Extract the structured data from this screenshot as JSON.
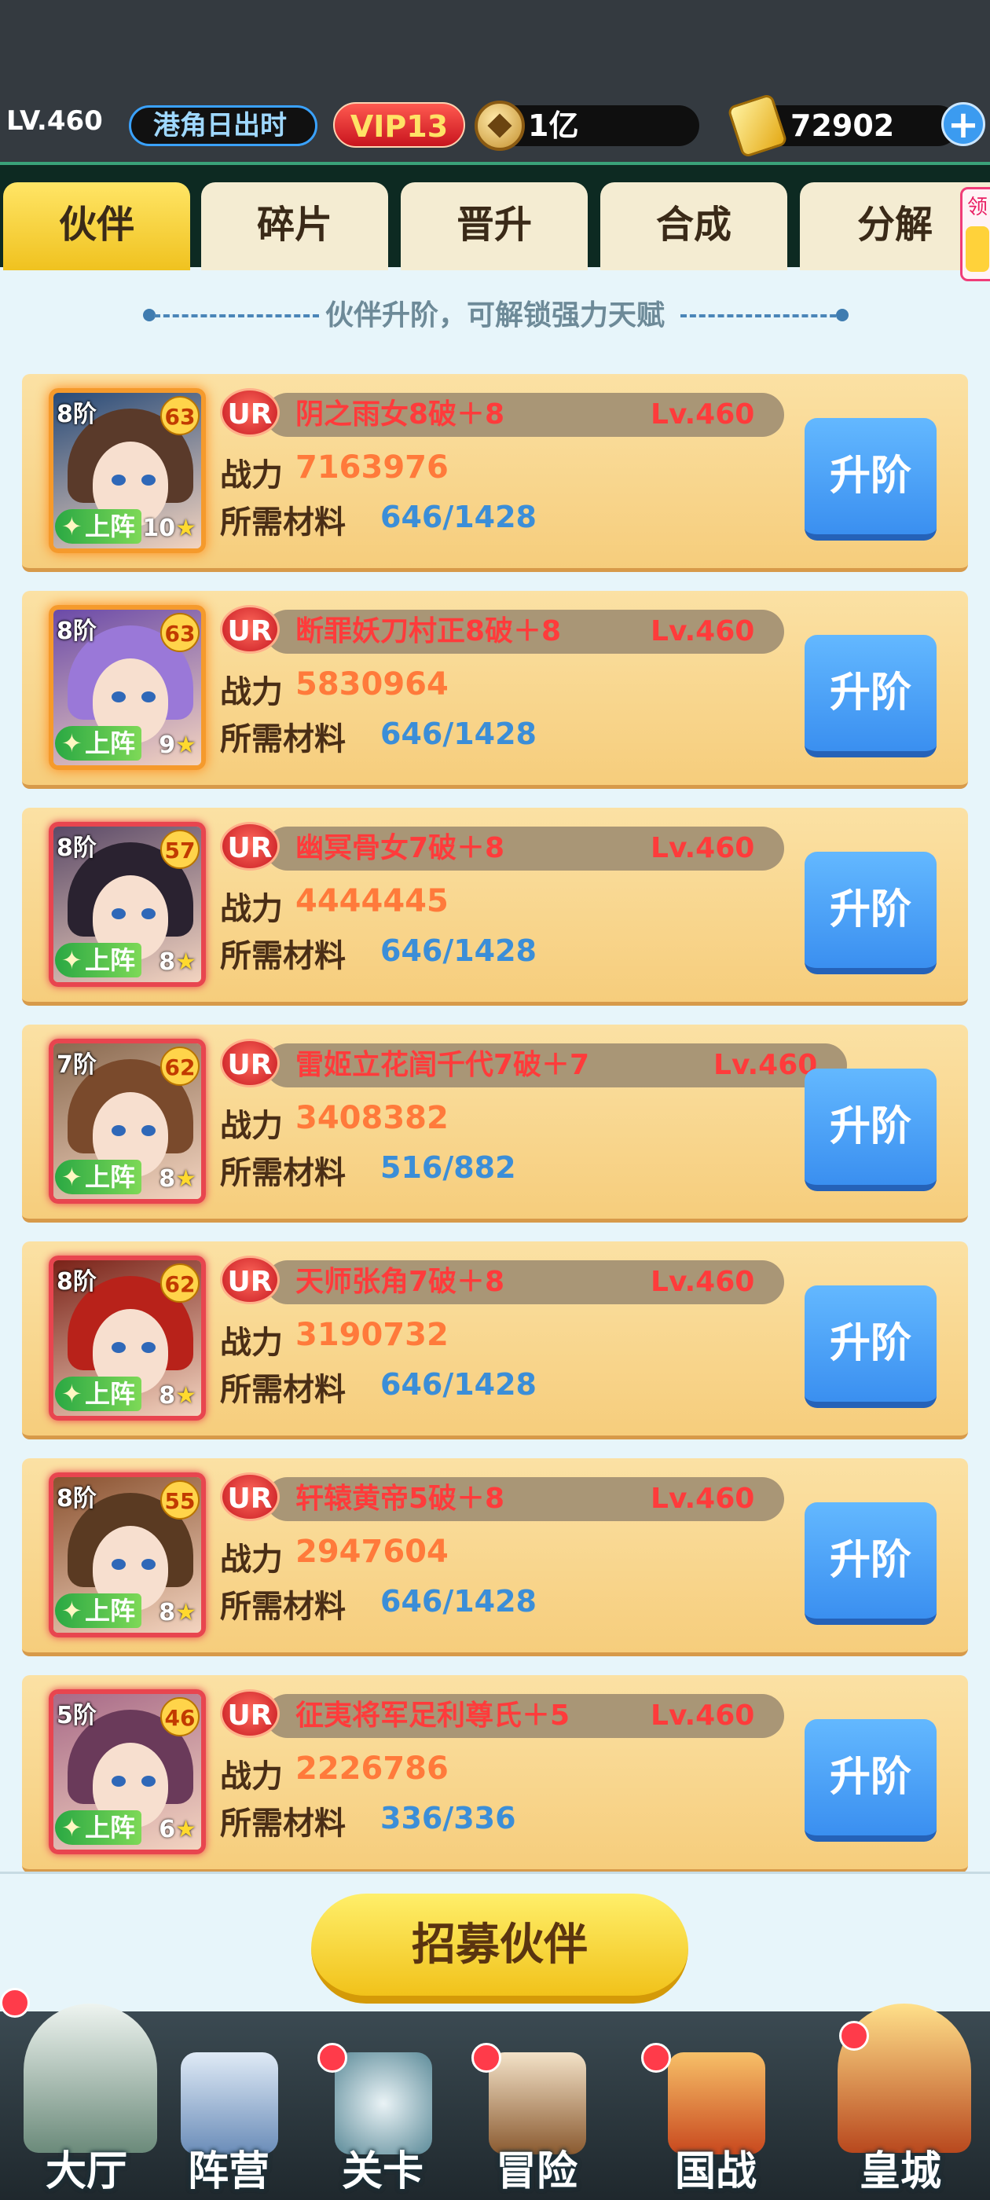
{
  "header": {
    "level": "LV.460",
    "player_name": "港角日出时",
    "vip": "VIP13",
    "coins": "1亿",
    "gold": "72902",
    "plus_icon": "plus-icon"
  },
  "tabs": [
    "伙伴",
    "碎片",
    "晋升",
    "合成",
    "分解"
  ],
  "active_tab": 0,
  "side_gift": "领",
  "hint": "伙伴升阶，可解锁强力天赋",
  "labels": {
    "power": "战力",
    "materials": "所需材料",
    "upgrade": "升阶",
    "deploy": "上阵",
    "rarity": "UR"
  },
  "partners": [
    {
      "tier": "8阶",
      "tier_level": "63",
      "stars": "10",
      "name": "阴之雨女8破＋8",
      "level": "Lv.460",
      "power": "7163976",
      "materials": "646/1428",
      "hair": "#5a3a2a",
      "bg": "#274a78",
      "frame": "orange"
    },
    {
      "tier": "8阶",
      "tier_level": "63",
      "stars": "9",
      "name": "断罪妖刀村正8破＋8",
      "level": "Lv.460",
      "power": "5830964",
      "materials": "646/1428",
      "hair": "#9a78d8",
      "bg": "#6b4aa8",
      "frame": "orange"
    },
    {
      "tier": "8阶",
      "tier_level": "57",
      "stars": "8",
      "name": "幽冥骨女7破＋8",
      "level": "Lv.460",
      "power": "4444445",
      "materials": "646/1428",
      "hair": "#2a2230",
      "bg": "#5b4a68",
      "frame": "red"
    },
    {
      "tier": "7阶",
      "tier_level": "62",
      "stars": "8",
      "name": "雷姬立花訚千代7破＋7",
      "level": "Lv.460",
      "power": "3408382",
      "materials": "516/882",
      "hair": "#7a4a2c",
      "bg": "#8a6a50",
      "frame": "red"
    },
    {
      "tier": "8阶",
      "tier_level": "62",
      "stars": "8",
      "name": "天师张角7破＋8",
      "level": "Lv.460",
      "power": "3190732",
      "materials": "646/1428",
      "hair": "#b8221a",
      "bg": "#7a2218",
      "frame": "red"
    },
    {
      "tier": "8阶",
      "tier_level": "55",
      "stars": "8",
      "name": "轩辕黄帝5破＋8",
      "level": "Lv.460",
      "power": "2947604",
      "materials": "646/1428",
      "hair": "#5a3a22",
      "bg": "#8a5230",
      "frame": "red"
    },
    {
      "tier": "5阶",
      "tier_level": "46",
      "stars": "6",
      "name": "征夷将军足利尊氏＋5",
      "level": "Lv.460",
      "power": "2226786",
      "materials": "336/336",
      "hair": "#6a3a5a",
      "bg": "#a86a88",
      "frame": "red"
    }
  ],
  "recruit_button": "招募伙伴",
  "nav": [
    {
      "label": "大厅",
      "icon": "castle-icon"
    },
    {
      "label": "阵营",
      "icon": "scroll-board-icon"
    },
    {
      "label": "关卡",
      "icon": "crossed-swords-icon"
    },
    {
      "label": "冒险",
      "icon": "ship-icon"
    },
    {
      "label": "国战",
      "icon": "war-banner-icon"
    },
    {
      "label": "皇城",
      "icon": "palace-icon"
    }
  ]
}
